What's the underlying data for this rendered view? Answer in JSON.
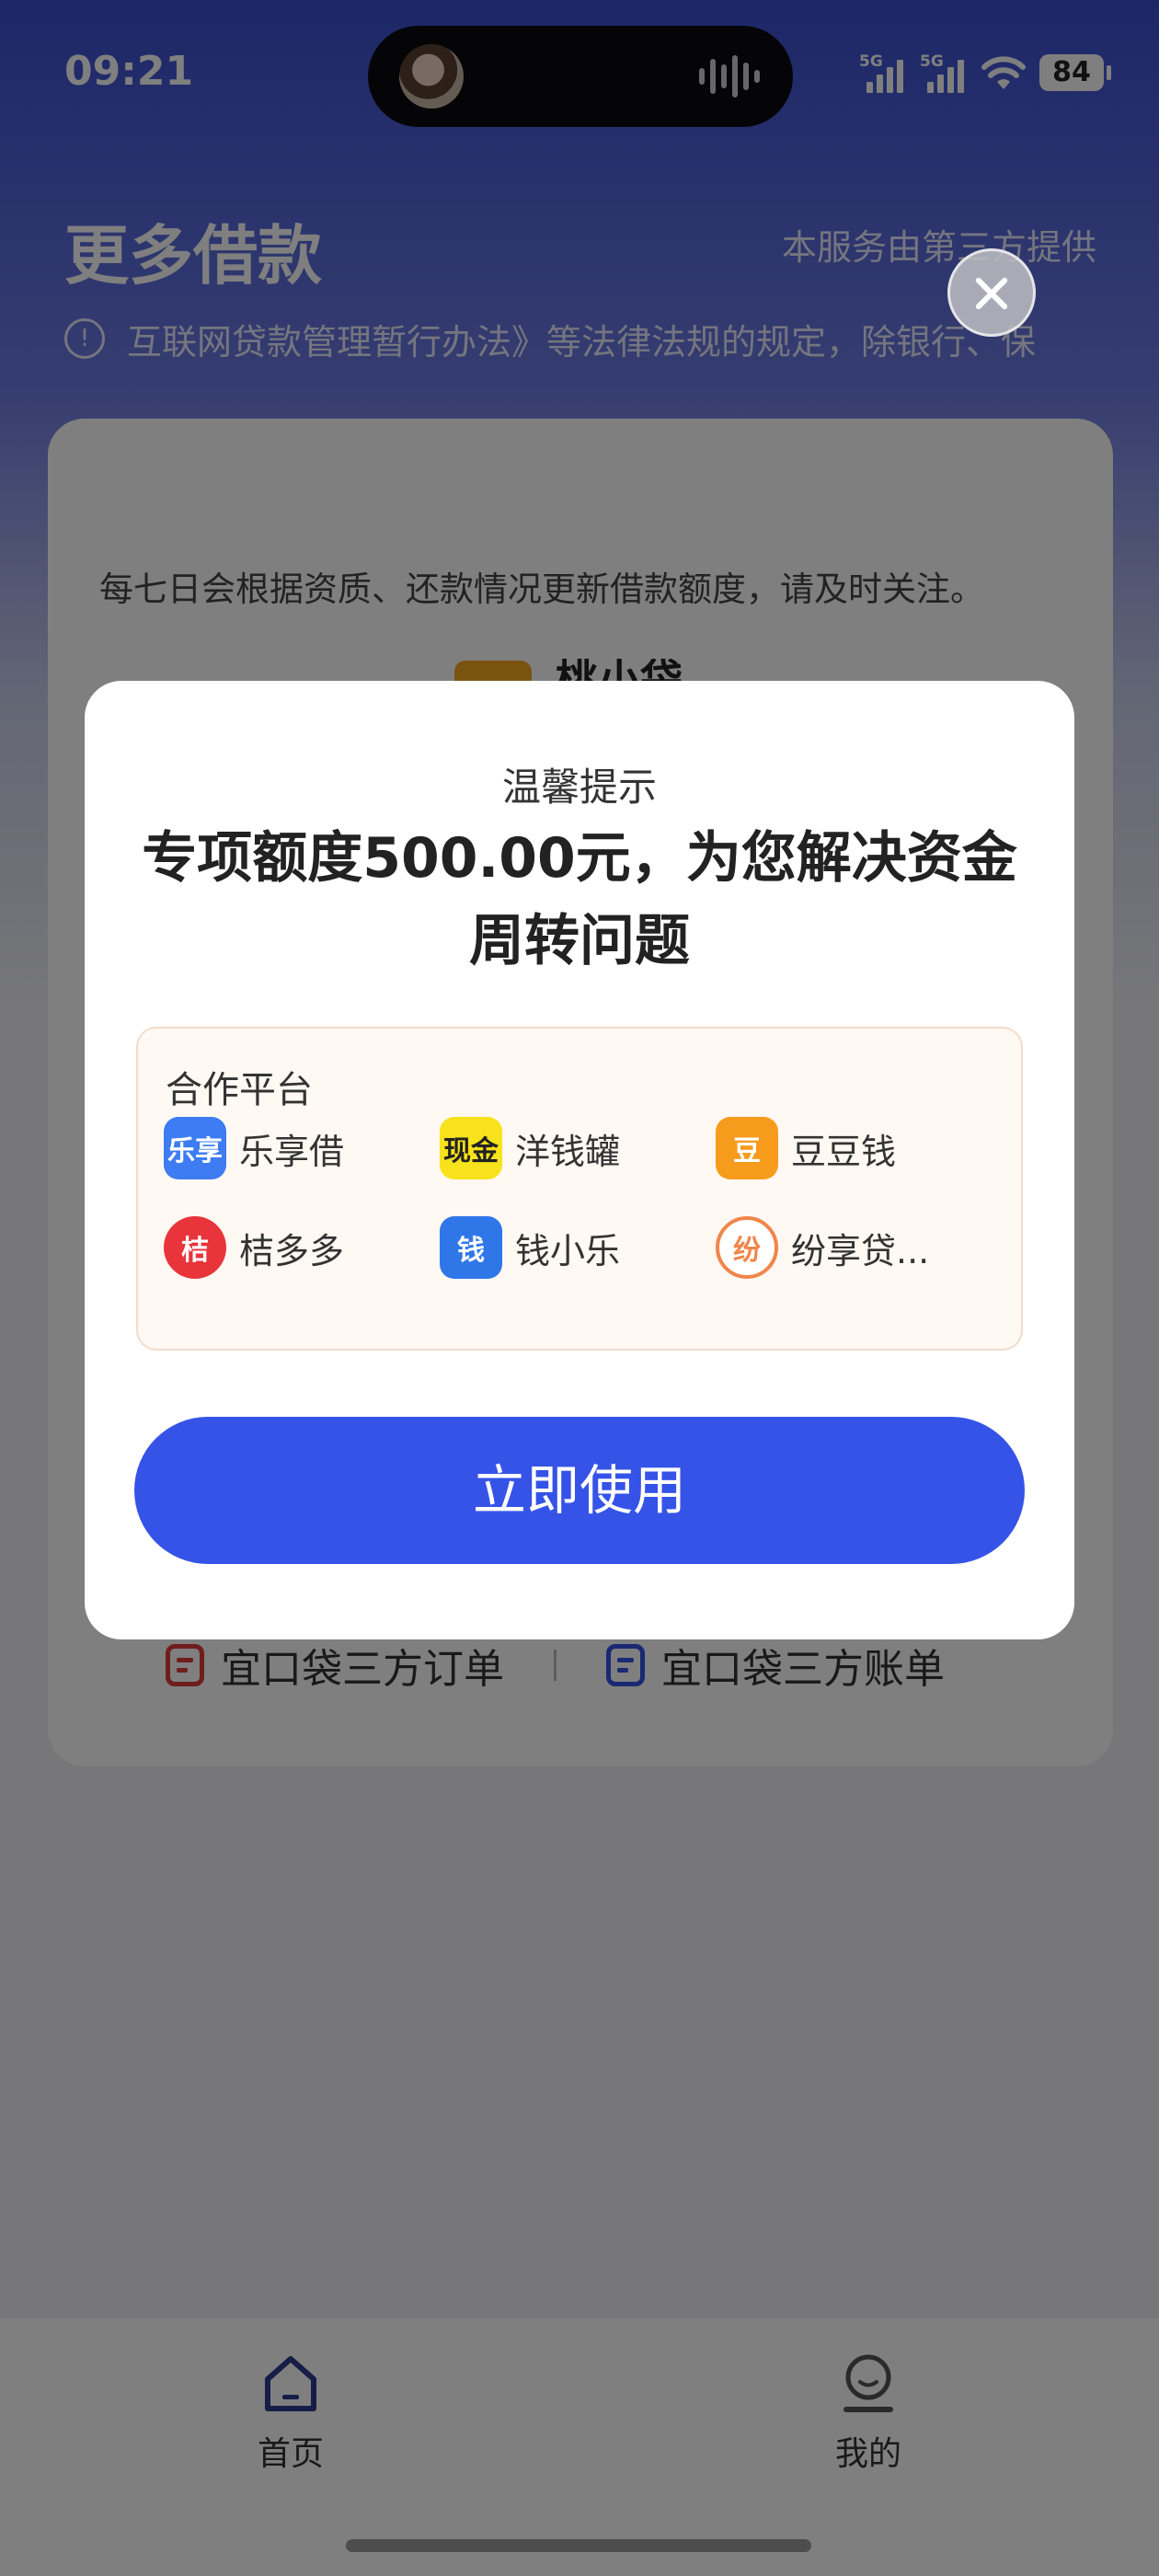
{
  "status_bar": {
    "time": "09:21",
    "signal_1": "5G",
    "signal_2": "5G",
    "battery": "84"
  },
  "header": {
    "title": "更多借款",
    "provider": "本服务由第三方提供",
    "notice": "互联网贷款管理暂行办法》等法律法规的规定，除银行、保"
  },
  "card": {
    "note": "每七日会根据资质、还款情况更新借款额度，请及时关注。",
    "brand_name": "桃小袋",
    "links": [
      {
        "label": "宜口袋三方订单",
        "color": "#e03a3a"
      },
      {
        "label": "宜口袋三方账单",
        "color": "#3553e7"
      }
    ]
  },
  "modal": {
    "subtitle": "温馨提示",
    "headline": "专项额度500.00元，为您解决资金周转问题",
    "partners_title": "合作平台",
    "partners": [
      {
        "name": "乐享借",
        "icon": "lexiang-icon",
        "logo_text": "乐享",
        "color": "#3d7cf2"
      },
      {
        "name": "洋钱罐",
        "icon": "yangqianguan-icon",
        "logo_text": "现金",
        "color": "#f7e21b"
      },
      {
        "name": "豆豆钱",
        "icon": "doudouqian-icon",
        "logo_text": "豆",
        "color": "#f79b1c"
      },
      {
        "name": "桔多多",
        "icon": "juduoduo-icon",
        "logo_text": "桔",
        "color": "#e8343a"
      },
      {
        "name": "钱小乐",
        "icon": "qianxiaole-icon",
        "logo_text": "钱",
        "color": "#2f76e8"
      },
      {
        "name": "纷享贷...",
        "icon": "fenxiangdai-icon",
        "logo_text": "纷",
        "color": "#f0864a"
      }
    ],
    "cta_label": "立即使用"
  },
  "tabbar": {
    "home_label": "首页",
    "mine_label": "我的",
    "accent": "#2c3a8c"
  }
}
